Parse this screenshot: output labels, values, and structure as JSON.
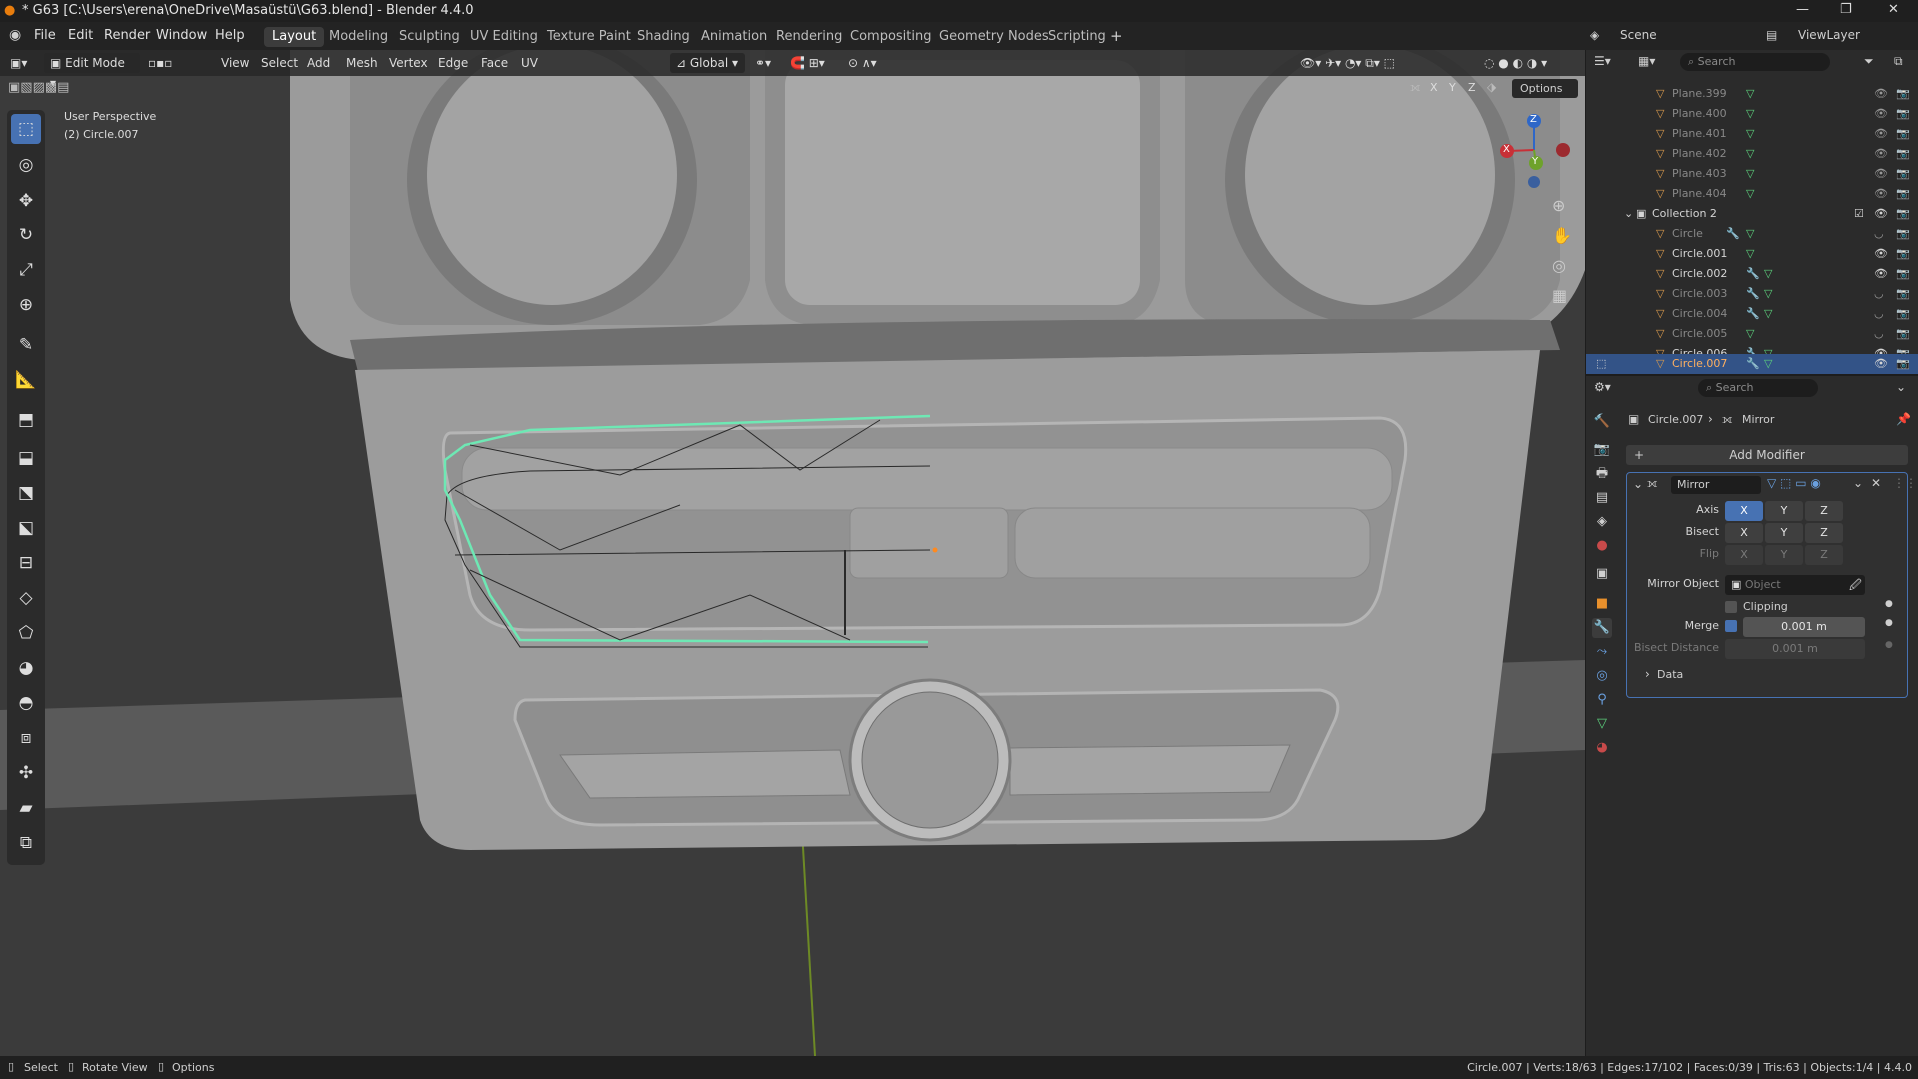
{
  "title": "* G63 [C:\\Users\\erena\\OneDrive\\Masaüstü\\G63.blend] - Blender 4.4.0",
  "menu": [
    "File",
    "Edit",
    "Render",
    "Window",
    "Help"
  ],
  "workspaces": [
    "Layout",
    "Modeling",
    "Sculpting",
    "UV Editing",
    "Texture Paint",
    "Shading",
    "Animation",
    "Rendering",
    "Compositing",
    "Geometry Nodes",
    "Scripting"
  ],
  "scene": "Scene",
  "view_layer": "ViewLayer",
  "viewport": {
    "mode": "Edit Mode",
    "menus": [
      "View",
      "Select",
      "Add",
      "Mesh",
      "Vertex",
      "Edge",
      "Face",
      "UV"
    ],
    "transform": "Global",
    "options": "Options",
    "xyz": [
      "X",
      "Y",
      "Z"
    ],
    "perspective": "User Perspective",
    "object_label": "(2) Circle.007"
  },
  "gizmo": {
    "z": "Z",
    "x": "X",
    "y": "Y"
  },
  "outliner": {
    "search": "Search",
    "rows": [
      {
        "name": "Plane.399"
      },
      {
        "name": "Plane.400"
      },
      {
        "name": "Plane.401"
      },
      {
        "name": "Plane.402"
      },
      {
        "name": "Plane.403"
      },
      {
        "name": "Plane.404"
      },
      {
        "name": "Collection 2"
      },
      {
        "name": "Circle"
      },
      {
        "name": "Circle.001"
      },
      {
        "name": "Circle.002"
      },
      {
        "name": "Circle.003"
      },
      {
        "name": "Circle.004"
      },
      {
        "name": "Circle.005"
      },
      {
        "name": "Circle.006"
      },
      {
        "name": "Circle.007"
      }
    ]
  },
  "properties": {
    "search": "Search",
    "breadcrumb_object": "Circle.007",
    "breadcrumb_modifier": "Mirror",
    "add_modifier": "Add Modifier",
    "modifier_name": "Mirror",
    "axis_label": "Axis",
    "bisect_label": "Bisect",
    "flip_label": "Flip",
    "axes": [
      "X",
      "Y",
      "Z"
    ],
    "mirror_object_label": "Mirror Object",
    "mirror_object_placeholder": "Object",
    "clipping_label": "Clipping",
    "merge_label": "Merge",
    "merge_value": "0.001 m",
    "bisect_distance_label": "Bisect Distance",
    "bisect_distance_value": "0.001 m",
    "data_label": "Data"
  },
  "status": {
    "select": "Select",
    "rotate": "Rotate View",
    "options": "Options",
    "stats": "Circle.007 | Verts:18/63 | Edges:17/102 | Faces:0/39 | Tris:63 | Objects:1/4 | 4.4.0"
  }
}
